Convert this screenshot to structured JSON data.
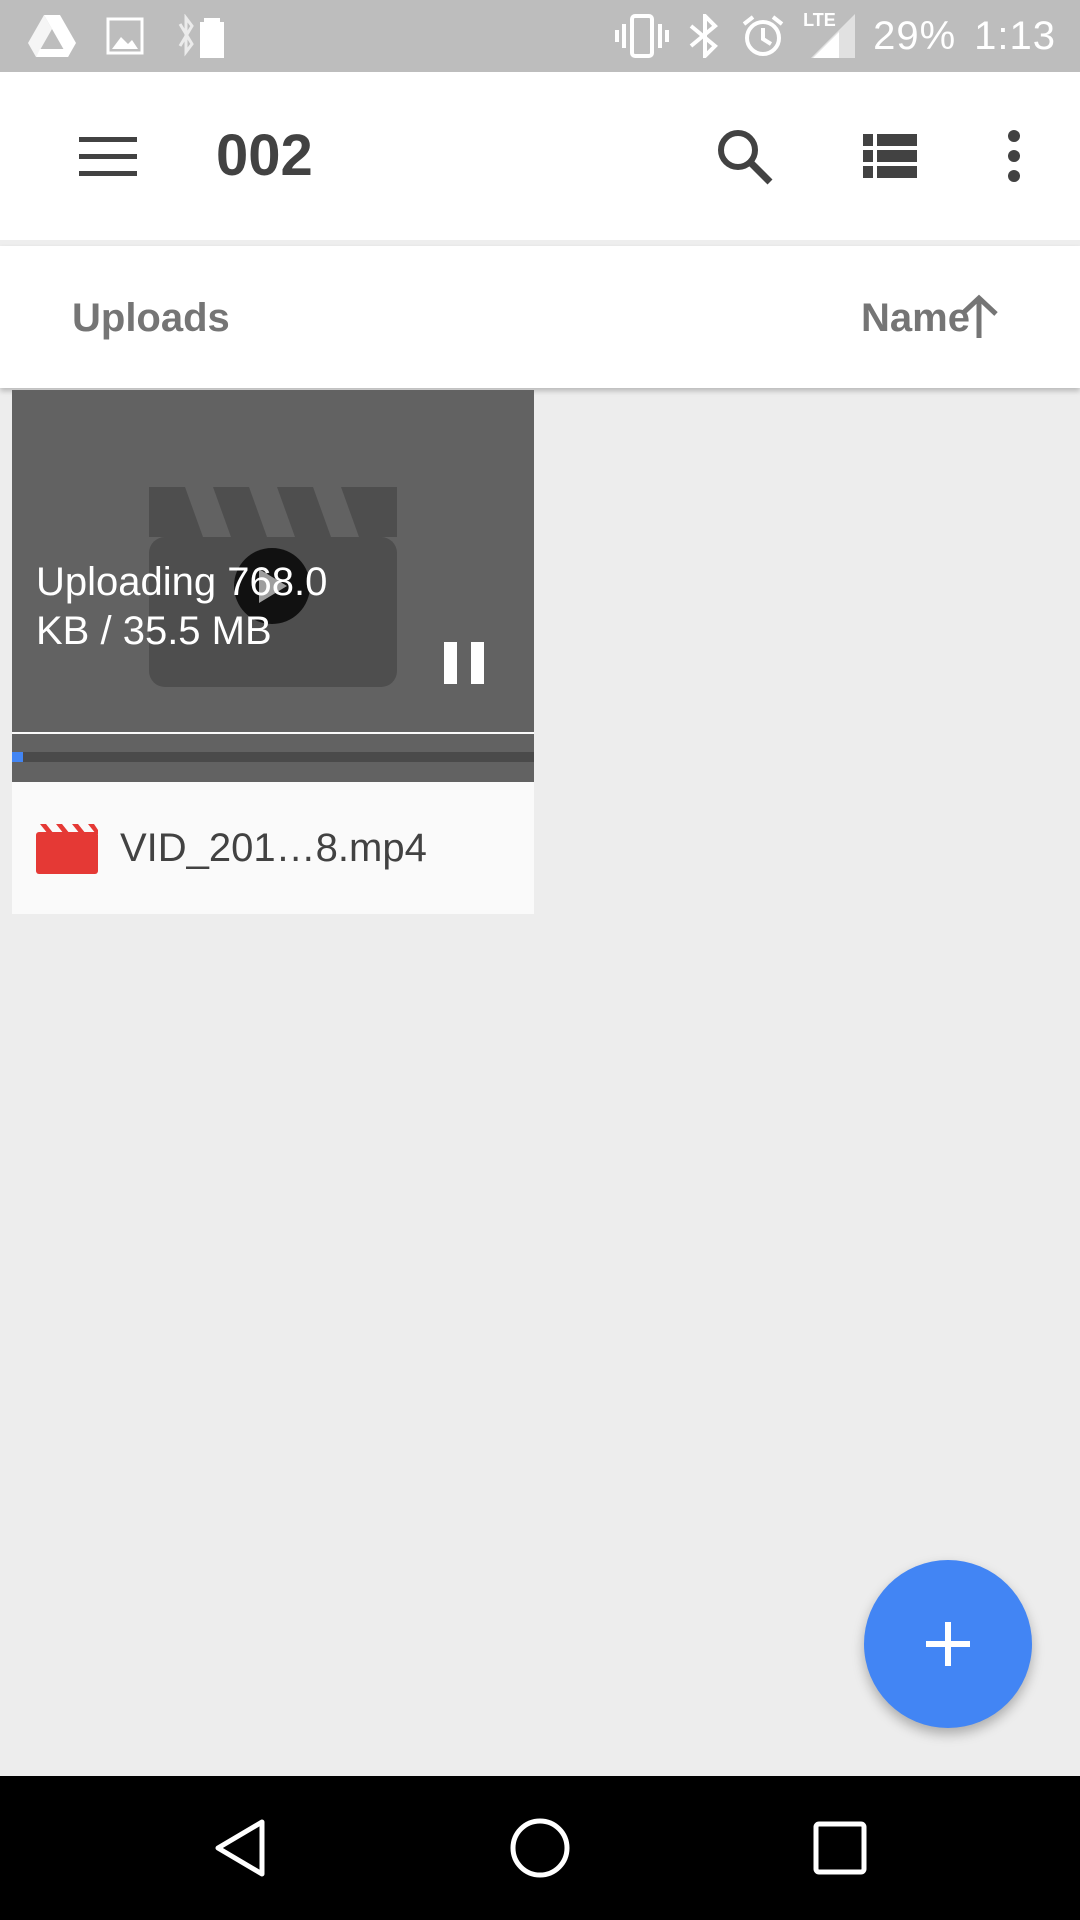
{
  "status_bar": {
    "battery": "29%",
    "time": "1:13",
    "network": "LTE",
    "icons": [
      "drive-icon",
      "image-icon",
      "bluetooth-battery-icon",
      "vibrate-icon",
      "bluetooth-icon",
      "alarm-icon",
      "signal-icon"
    ]
  },
  "toolbar": {
    "title": "002",
    "icons": [
      "menu-icon",
      "search-icon",
      "list-view-icon",
      "more-vert-icon"
    ]
  },
  "sort_bar": {
    "section_label": "Uploads",
    "sort_label": "Name",
    "sort_direction_icon": "arrow-up-icon"
  },
  "upload_card": {
    "status_text": "Uploading 768.0 KB / 35.5 MB",
    "progress_fraction": 0.021,
    "file_name": "VID_201…8.mp4",
    "icons": [
      "video-clapper-icon",
      "play-icon",
      "pause-icon",
      "video-file-icon"
    ]
  },
  "fab": {
    "icon": "plus-icon"
  },
  "nav_bar": {
    "icons": [
      "back-icon",
      "home-icon",
      "recents-icon"
    ]
  },
  "colors": {
    "accent": "#4285f4",
    "file_icon_red": "#e53935",
    "status_bar": "#bdbdbd",
    "background": "#ededed"
  }
}
